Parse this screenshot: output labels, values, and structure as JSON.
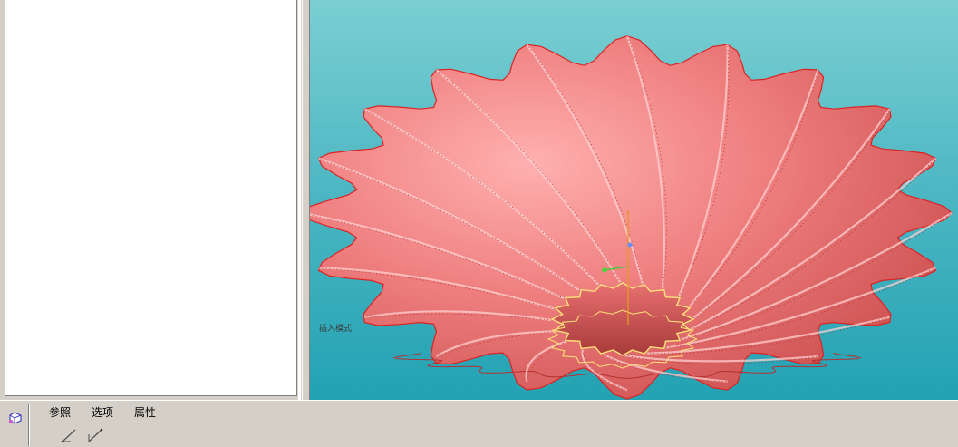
{
  "viewport": {
    "mode_label": "插入模式",
    "background_top": "#7bcfd2",
    "background_bottom": "#22a2b3",
    "model_color": "#ef7f7f"
  },
  "dashboard": {
    "tabs": [
      {
        "label": "参照"
      },
      {
        "label": "选项"
      },
      {
        "label": "属性"
      }
    ],
    "icons": [
      "feature-sketch-icon",
      "line-tool-icon",
      "slope-line-tool-icon"
    ]
  }
}
